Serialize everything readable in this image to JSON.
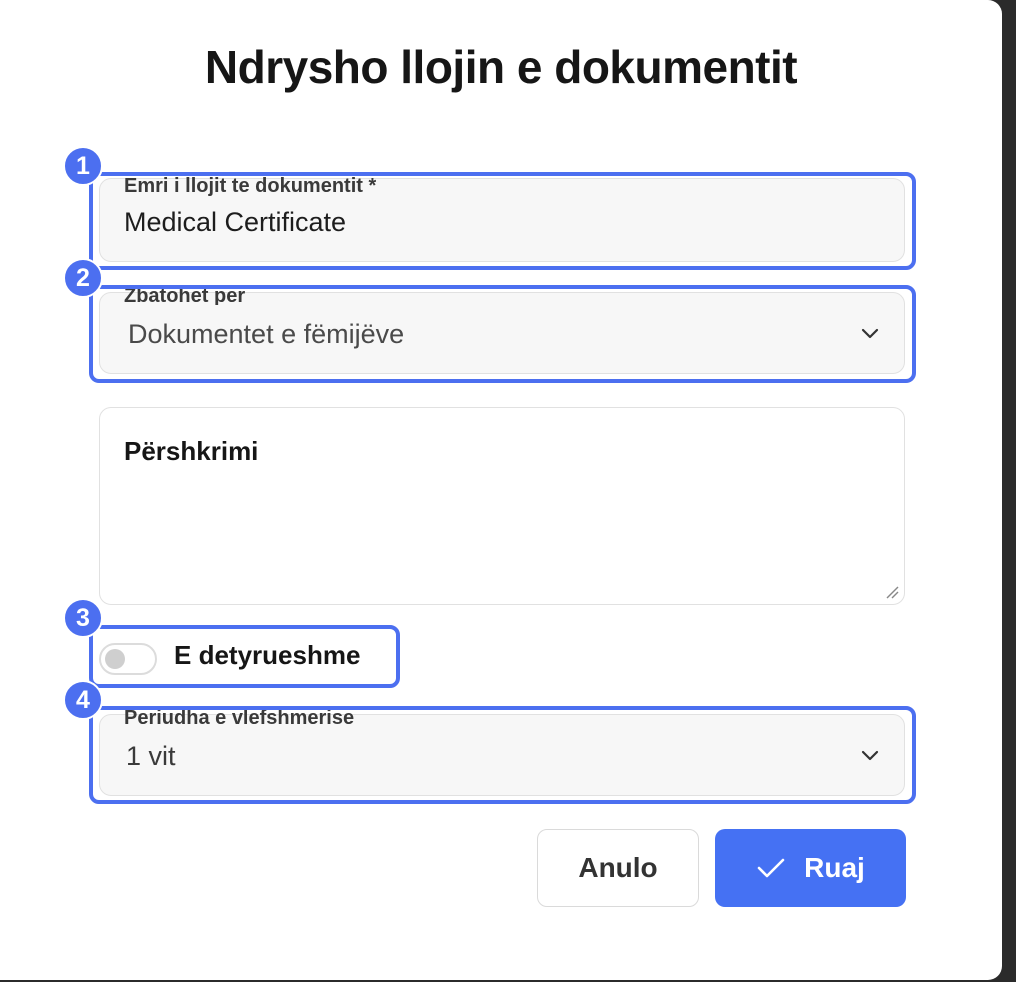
{
  "dialog": {
    "title": "Ndrysho llojin e dokumentit"
  },
  "fields": {
    "name": {
      "label": "Emri i llojit te dokumentit *",
      "value": "Medical Certificate"
    },
    "applies_to": {
      "label": "Zbatohet per",
      "value": "Dokumentet e fëmijëve"
    },
    "description": {
      "placeholder": "Përshkrimi"
    },
    "mandatory": {
      "label": "E detyrueshme",
      "checked": false
    },
    "validity": {
      "label": "Periudha e vlefshmerise",
      "value": "1 vit"
    }
  },
  "buttons": {
    "cancel": "Anulo",
    "save": "Ruaj"
  },
  "annotations": [
    "1",
    "2",
    "3",
    "4"
  ],
  "colors": {
    "accent": "#4c6ff0",
    "save_button": "#4571f3"
  },
  "icons": {
    "select_arrow": "chevron-down-icon",
    "save": "check-icon",
    "resize": "resize-handle-icon"
  }
}
